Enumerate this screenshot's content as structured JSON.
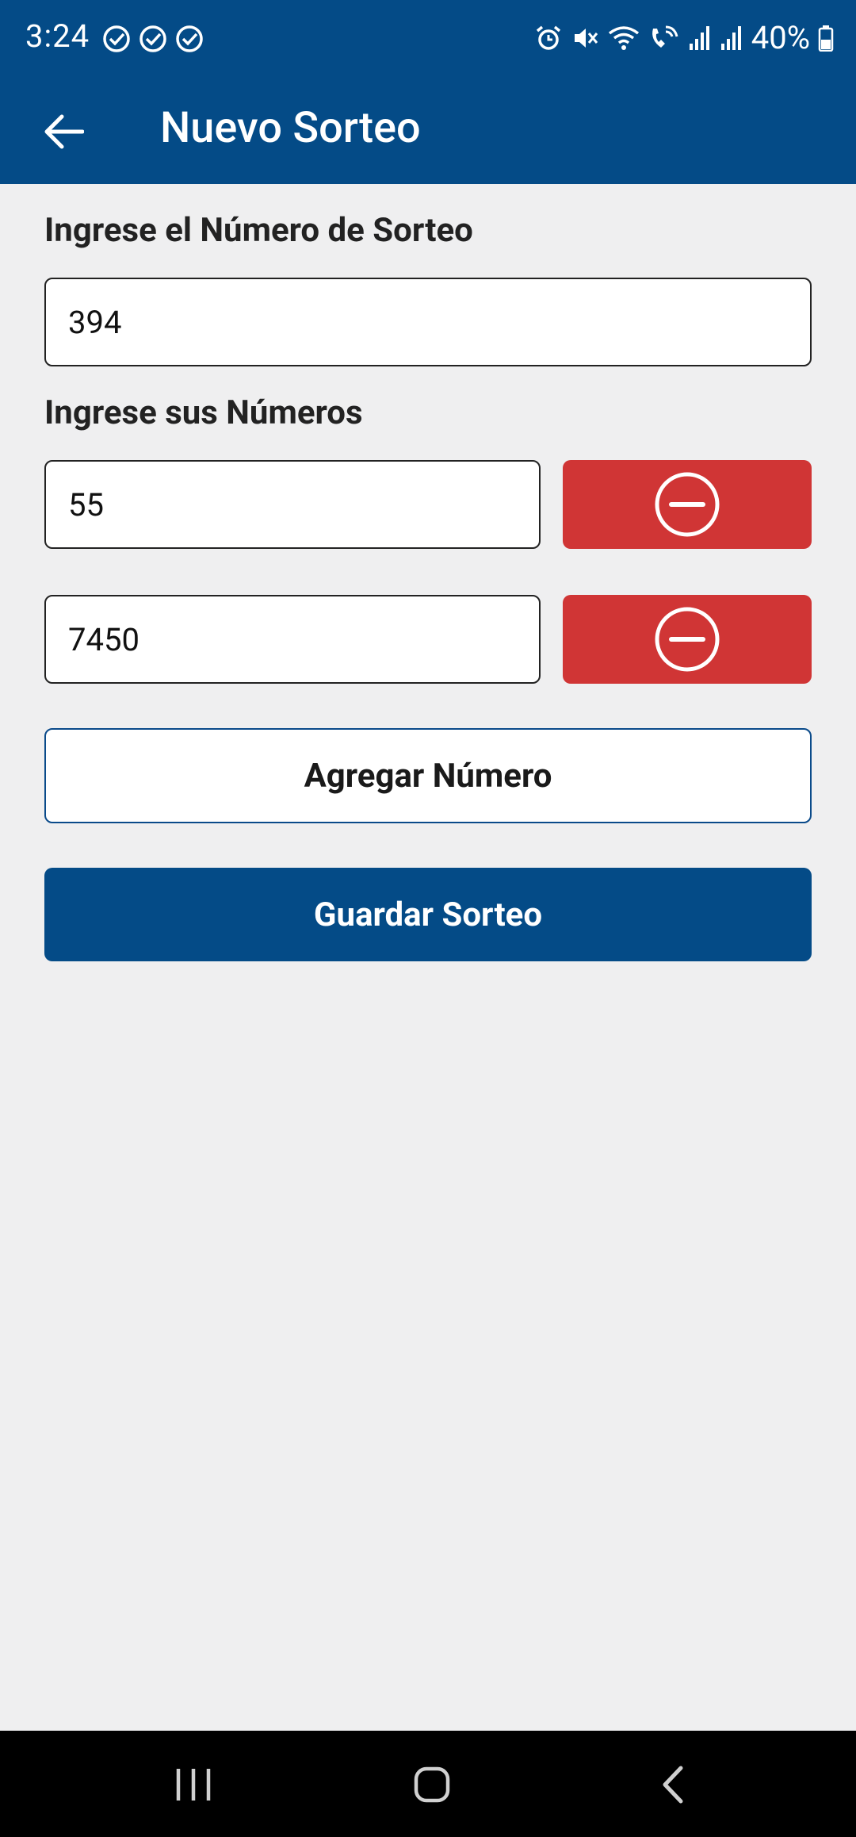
{
  "status_bar": {
    "time": "3:24",
    "battery": "40%"
  },
  "app_bar": {
    "title": "Nuevo Sorteo"
  },
  "draw_number": {
    "label": "Ingrese el Número de Sorteo",
    "value": "394"
  },
  "numbers": {
    "label": "Ingrese sus Números",
    "items": [
      {
        "value": "55"
      },
      {
        "value": "7450"
      }
    ]
  },
  "actions": {
    "add_label": "Agregar Número",
    "save_label": "Guardar Sorteo"
  },
  "colors": {
    "primary": "#044b87",
    "danger": "#d03535",
    "background": "#efeff0"
  },
  "icons": {
    "back": "arrow-left-icon",
    "remove": "minus-circle-icon",
    "nav_recents": "recents-icon",
    "nav_home": "home-icon",
    "nav_back": "nav-back-icon"
  }
}
